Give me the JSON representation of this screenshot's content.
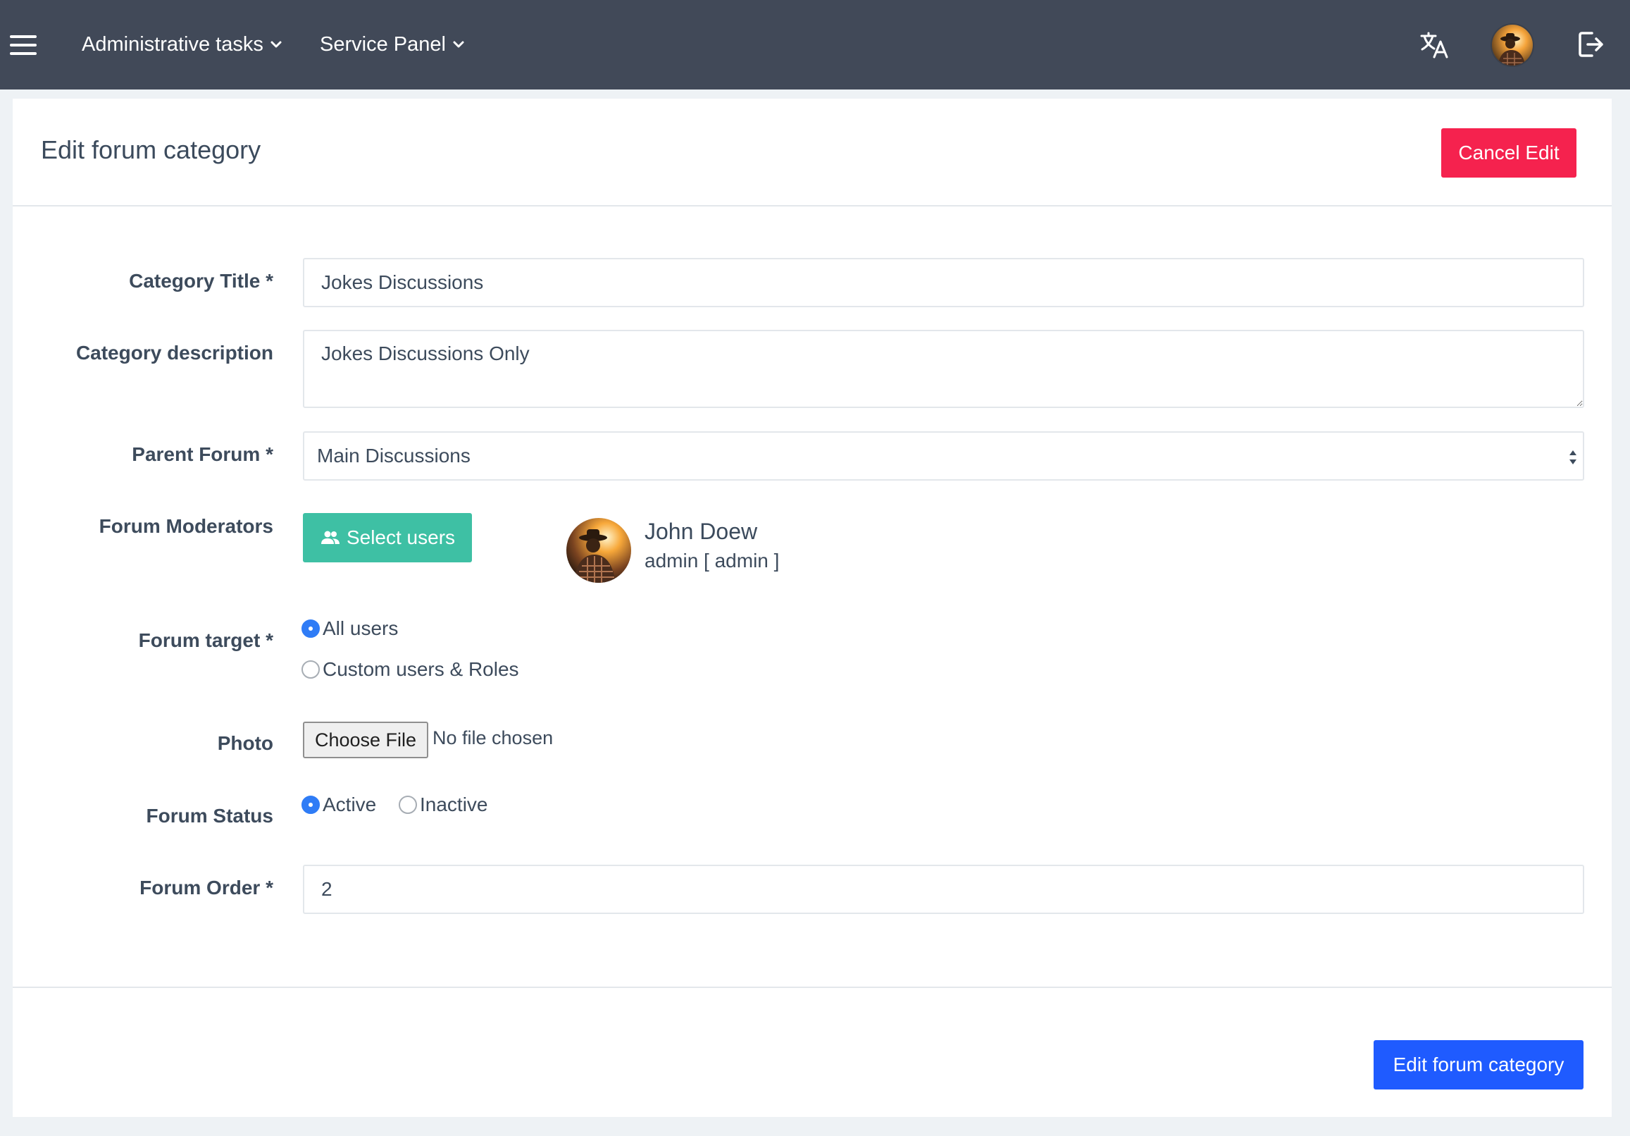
{
  "navbar": {
    "menu_icon": "hamburger-icon",
    "menus": [
      {
        "label": "Administrative tasks"
      },
      {
        "label": "Service Panel"
      }
    ],
    "icons": [
      "translate-icon",
      "avatar",
      "logout-icon"
    ]
  },
  "page": {
    "title": "Edit forum category",
    "cancel_label": "Cancel Edit",
    "submit_label": "Edit forum category"
  },
  "form": {
    "category_title": {
      "label": "Category Title",
      "value": "Jokes Discussions"
    },
    "category_description": {
      "label": "Category description",
      "value": "Jokes Discussions Only"
    },
    "parent_forum": {
      "label": "Parent Forum",
      "value": "Main Discussions"
    },
    "moderators": {
      "label": "Forum Moderators",
      "button_label": "Select users",
      "users": [
        {
          "name": "John Doew",
          "role": "admin [ admin ]"
        }
      ]
    },
    "forum_target": {
      "label": "Forum target",
      "options": [
        {
          "label": "All users",
          "selected": true
        },
        {
          "label": "Custom users & Roles",
          "selected": false
        }
      ]
    },
    "photo": {
      "label": "Photo",
      "button_label": "Choose File",
      "status": "No file chosen"
    },
    "forum_status": {
      "label": "Forum Status",
      "options": [
        {
          "label": "Active",
          "selected": true
        },
        {
          "label": "Inactive",
          "selected": false
        }
      ]
    },
    "forum_order": {
      "label": "Forum Order",
      "value": "2"
    }
  },
  "colors": {
    "navbar": "#414958",
    "cancel": "#f5224e",
    "select_users": "#3ec0a4",
    "submit": "#1f5bff",
    "radio_selected": "#2f7cf6"
  }
}
